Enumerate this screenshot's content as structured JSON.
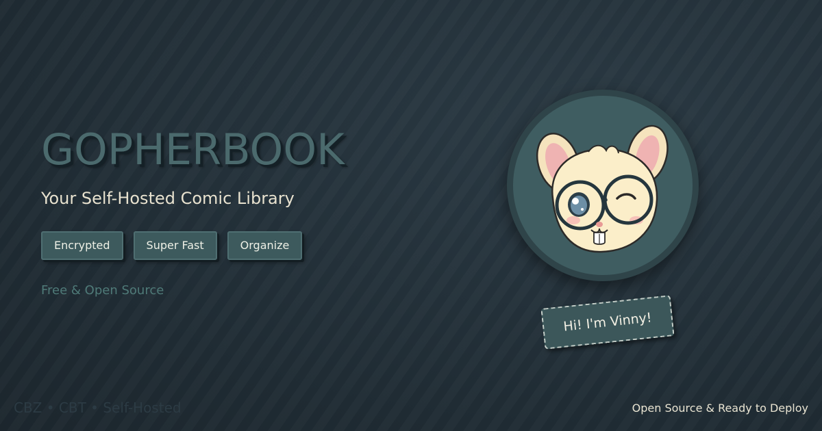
{
  "hero": {
    "title": "GOPHERBOOK",
    "tagline": "Your Self-Hosted Comic Library",
    "features": [
      "Encrypted",
      "Super Fast",
      "Organize"
    ],
    "license_note": "Free & Open Source"
  },
  "mascot": {
    "image": "hamster-mascot-with-glasses-winking",
    "speech": "Hi! I'm Vinny!"
  },
  "footer": {
    "formats": "CBZ • CBT • Self-Hosted",
    "status": "Open Source & Ready to Deploy"
  },
  "colors": {
    "background": "#222f38",
    "accent": "#3d5a5d",
    "title": "#4b6a6d",
    "text": "#e8e2cf",
    "muted": "#4f7a78"
  }
}
